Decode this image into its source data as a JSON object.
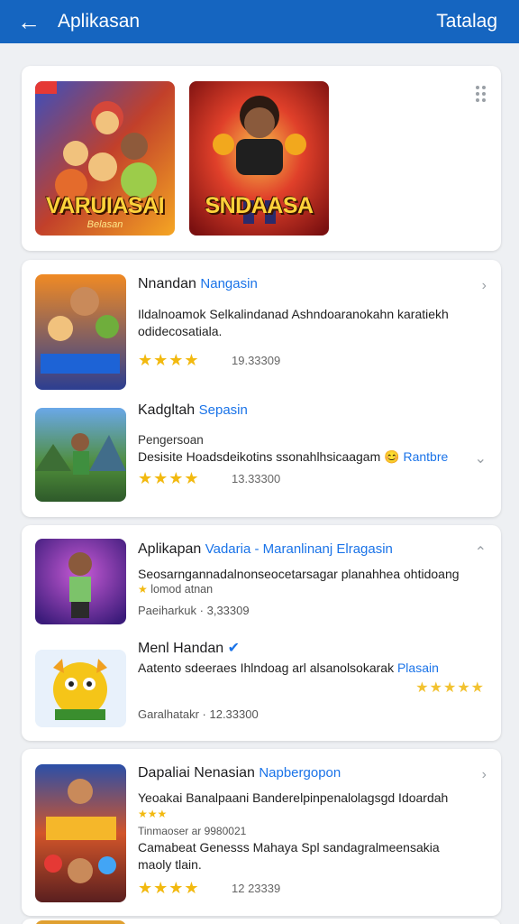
{
  "appbar": {
    "back_icon": "arrow-left-icon",
    "title": "Aplikasan",
    "action": "Tatalag"
  },
  "featured": {
    "items": [
      {
        "caption": "VARUIASAI",
        "subcaption": "Belasan"
      },
      {
        "caption": "SNDAASA",
        "subcaption": ""
      }
    ]
  },
  "lists": [
    {
      "items": [
        {
          "title": "Nnandan",
          "accent": "Nangasin",
          "line1": "Ildalnoamok Selkalindanad Ashndoaranokahn karatiekh",
          "line2": "odidecosatiala.",
          "stars": "★★★★",
          "rating": "19.33309"
        },
        {
          "title": "Kadgltah",
          "accent": "Sepasin",
          "line1": "Pengersoan",
          "line2": "Desisite Hoadsdeikotins ssonahlhsicaagam",
          "pill": "Rantbre",
          "stars": "★★★★",
          "rating": "13.33300"
        }
      ]
    },
    {
      "items": [
        {
          "title": "Aplikapan",
          "accent": "Vadaria - Maranlinanj Elragasin",
          "line1": "Seosarngannadalnonseocetarsagar planahhea ohtidoang",
          "line2": "lomod atnan",
          "meta": "Paeiharkuk",
          "rating": "3,33309"
        },
        {
          "title": "Menl Handan",
          "line1": "Aatento sdeeraes Ihlndoag arl alsanolsokarak",
          "pill": "Plasain",
          "meta": "Garalhatakr",
          "rating": "12.33300"
        }
      ]
    },
    {
      "items": [
        {
          "title": "Dapaliai Nenasian",
          "accent": "Napbergopon",
          "line1": "Yeoakai Banalpaani Banderelpinpenalolagsgd Idoardah",
          "line2": "Tinmaoser ar 9980021",
          "line3": "Camabeat Genesss Mahaya Spl sandagralmeensakia",
          "line4": "maoly tlain.",
          "stars": "★★★★",
          "rating": "12 23339"
        }
      ]
    }
  ]
}
